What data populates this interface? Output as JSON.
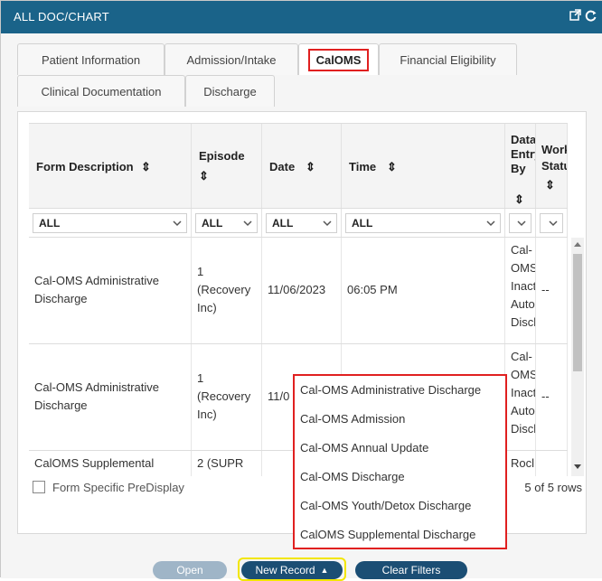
{
  "window": {
    "title": "ALL DOC/CHART"
  },
  "tabs": [
    {
      "label": "Patient Information"
    },
    {
      "label": "Admission/Intake"
    },
    {
      "label": "CalOMS"
    },
    {
      "label": "Financial Eligibility"
    },
    {
      "label": "Clinical Documentation"
    },
    {
      "label": "Discharge"
    }
  ],
  "grid": {
    "columns": [
      {
        "label": "Form Description",
        "sort": "⇕"
      },
      {
        "label": "Episode",
        "sort": "⇕"
      },
      {
        "label": "Date",
        "sort": "⇕"
      },
      {
        "label": "Time",
        "sort": "⇕"
      },
      {
        "label": "Data Entry By",
        "sort": "⇕"
      },
      {
        "label": "Workflow Status",
        "sort": "⇕"
      }
    ],
    "filters": [
      "ALL",
      "ALL",
      "ALL",
      "ALL",
      "",
      ""
    ],
    "rows": [
      {
        "form": "Cal-OMS Administrative Discharge",
        "episode": "1 (Recovery Inc)",
        "date": "11/06/2023",
        "time": "06:05 PM",
        "entry_by": "Cal-OMS Inactive Auto Discharge",
        "status": "--"
      },
      {
        "form": "Cal-OMS Administrative Discharge",
        "episode": "1 (Recovery Inc)",
        "date": "11/0",
        "time": "",
        "entry_by": "Cal-OMS Inactive Auto Discharge",
        "status": "--"
      },
      {
        "form": "CalOMS Supplemental",
        "episode": "2 (SUPR",
        "date": "",
        "time": "",
        "entry_by": "Rocl",
        "status": ""
      }
    ],
    "row_count": "5 of 5 rows",
    "prefilter_label": "Form Specific PreDisplay"
  },
  "new_record_menu": {
    "items": [
      "Cal-OMS Administrative Discharge",
      "Cal-OMS Admission",
      "Cal-OMS Annual Update",
      "Cal-OMS Discharge",
      "Cal-OMS Youth/Detox Discharge",
      "CalOMS Supplemental Discharge"
    ]
  },
  "buttons": {
    "open": "Open",
    "new_record": "New Record",
    "clear_filters": "Clear Filters"
  },
  "colors": {
    "titlebar": "#1a6389",
    "highlight_red": "#e02020",
    "highlight_yellow": "#f2e600",
    "button_dark": "#1b4e74",
    "button_disabled": "#9fb5c7"
  }
}
